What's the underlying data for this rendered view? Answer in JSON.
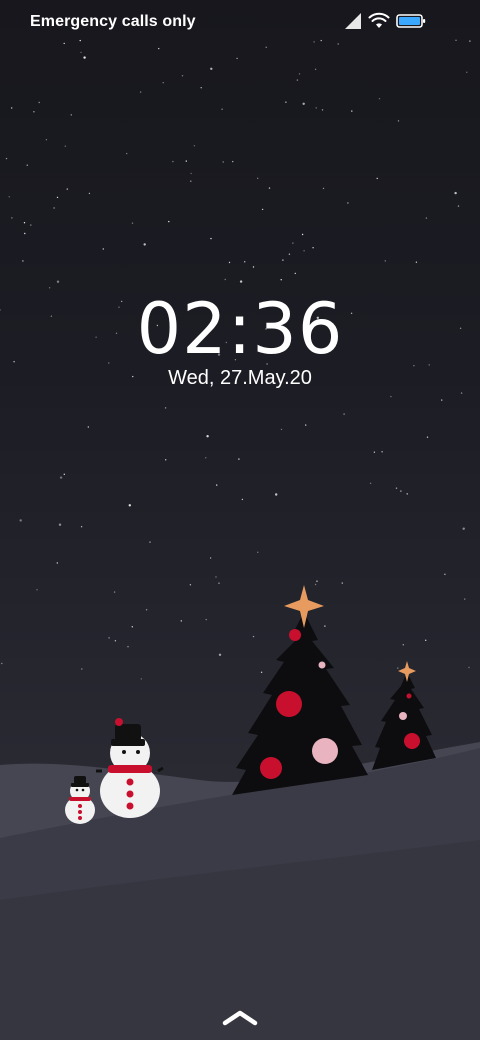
{
  "status_bar": {
    "carrier_text": "Emergency calls only",
    "icons": [
      "signal-icon",
      "wifi-icon",
      "battery-icon"
    ],
    "battery_color": "#3ba7ff"
  },
  "lock_screen": {
    "time": "02:36",
    "date": "Wed, 27.May.20"
  },
  "wallpaper": {
    "theme": "winter night with christmas trees and snowmen",
    "sky_color": "#1a1a21",
    "ground_color": "#3c3d48",
    "star_color": "#e9c08a",
    "ornament_red": "#c8102e",
    "ornament_pink": "#e9b3c0"
  },
  "bottom": {
    "icon": "chevron-up-icon"
  }
}
